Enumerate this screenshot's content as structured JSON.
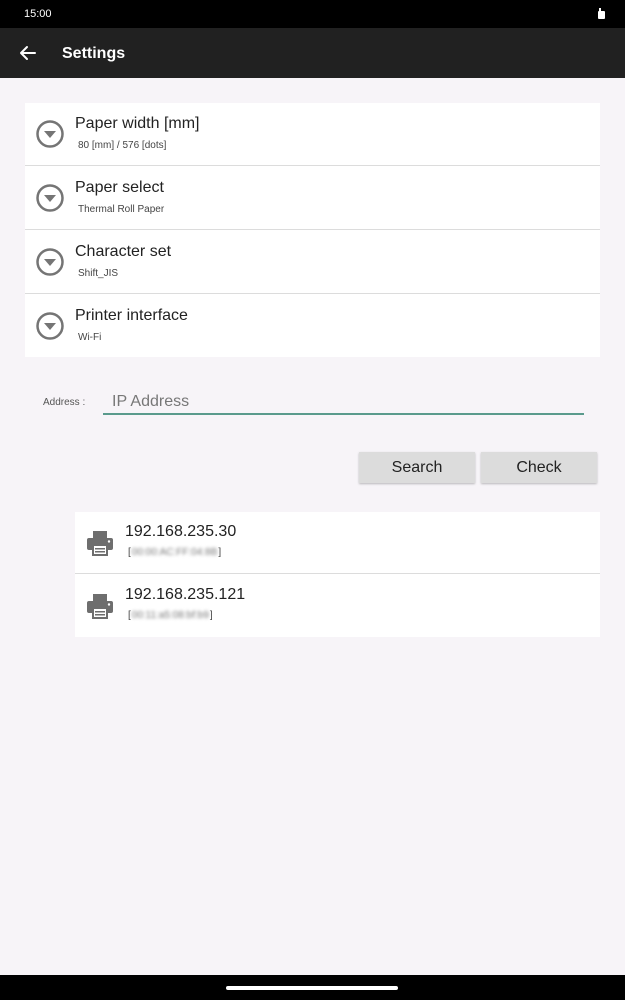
{
  "status_bar": {
    "time": "15:00",
    "icon": "notification-icon"
  },
  "app_bar": {
    "title": "Settings",
    "back_icon": "arrow-back-icon"
  },
  "settings": [
    {
      "title": "Paper width [mm]",
      "value": "80 [mm] / 576 [dots]",
      "icon": "dropdown-circle-icon"
    },
    {
      "title": "Paper select",
      "value": "Thermal Roll Paper",
      "icon": "dropdown-circle-icon"
    },
    {
      "title": "Character set",
      "value": "Shift_JIS",
      "icon": "dropdown-circle-icon"
    },
    {
      "title": "Printer interface",
      "value": "Wi-Fi",
      "icon": "dropdown-circle-icon"
    }
  ],
  "address": {
    "label": "Address :",
    "placeholder": "IP Address",
    "value": ""
  },
  "buttons": {
    "search": "Search",
    "check": "Check"
  },
  "printers": [
    {
      "ip": "192.168.235.30",
      "mac": "00:00:AC:FF:04:8B",
      "bracket_open": "[",
      "bracket_close": "]",
      "icon": "printer-icon"
    },
    {
      "ip": "192.168.235.121",
      "mac": "00:11:a5:08:bf:b9",
      "bracket_open": "[",
      "bracket_close": "]",
      "icon": "printer-icon"
    }
  ],
  "colors": {
    "app_bar": "#212121",
    "accent_underline": "#5a9a8c",
    "background": "#f7f4f8"
  }
}
